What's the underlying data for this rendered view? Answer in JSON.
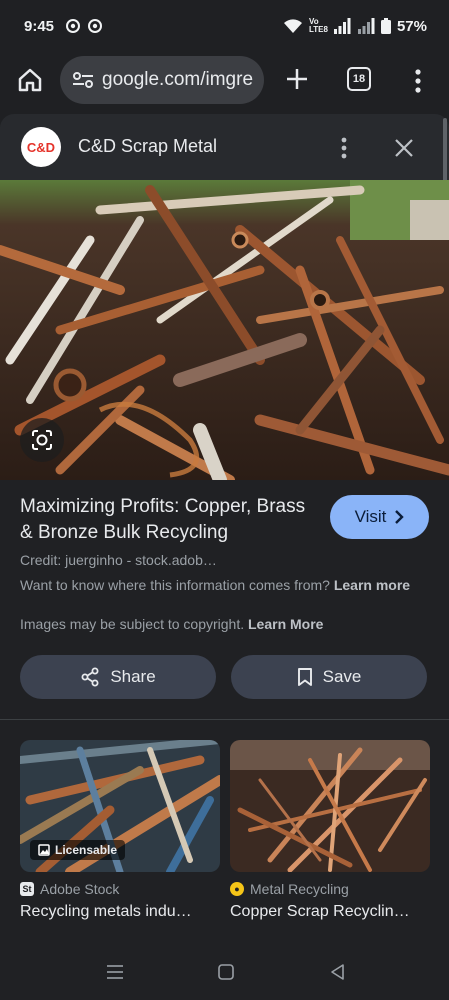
{
  "status_bar": {
    "time": "9:45",
    "network_label": "Vo LTE8",
    "battery": "57%",
    "icons": [
      "chrome-icon",
      "chrome-icon",
      "wifi-icon",
      "signal-icon",
      "signal-icon",
      "battery-icon"
    ]
  },
  "browser": {
    "url": "google.com/imgre",
    "tab_count": "18",
    "icons": [
      "home-icon",
      "site-settings-icon",
      "plus-icon",
      "tabs-icon",
      "more-vert-icon"
    ]
  },
  "panel": {
    "site_logo_text": "C&D",
    "site_name": "C&D Scrap Metal",
    "title": "Maximizing Profits: Copper, Brass & Bronze Bulk Recycling",
    "visit_label": "Visit",
    "credit": "Credit: juerginho - stock.adob…",
    "info_text": "Want to know where this information comes from?",
    "info_link": "Learn more",
    "copyright_text": "Images may be subject to copyright.",
    "copyright_link": "Learn More",
    "share_label": "Share",
    "save_label": "Save",
    "colors": {
      "accent": "#8ab4f8",
      "button_bg": "#3c4250",
      "logo_red": "#e5332a"
    }
  },
  "related": [
    {
      "badge": "Licensable",
      "source": "Adobe Stock",
      "title": "Recycling metals indu…"
    },
    {
      "badge": "",
      "source": "Metal Recycling",
      "title": "Copper Scrap Recyclin…"
    }
  ],
  "nav": {
    "icons": [
      "recents-icon",
      "home-icon",
      "back-icon"
    ]
  }
}
